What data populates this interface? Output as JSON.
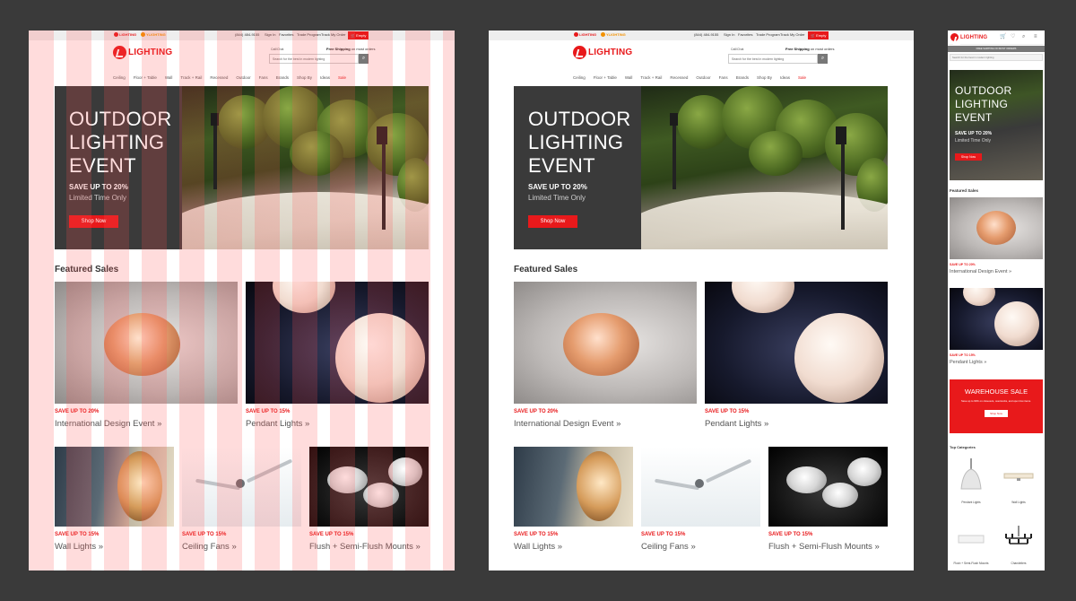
{
  "topbar": {
    "brand1": "LIGHTING",
    "brand2": "YLIGHTING",
    "phone": "(844) 484-9155",
    "links": [
      "Sign In",
      "Favorites",
      "Trade Program",
      "Track My Order"
    ],
    "cart": "Empty",
    "call_us": "Call/Chat"
  },
  "logo": {
    "text": "LIGHTING"
  },
  "shipping": {
    "bold": "Free Shipping",
    "rest": " on most orders"
  },
  "search": {
    "placeholder": "Search for the best in modern lighting"
  },
  "nav": [
    "Ceiling",
    "Floor + Table",
    "Wall",
    "Track + Rail",
    "Recessed",
    "Outdoor",
    "Fans",
    "Brands",
    "Shop By",
    "Ideas",
    "Sale"
  ],
  "hero": {
    "title_lines": [
      "OUTDOOR",
      "LIGHTING",
      "EVENT"
    ],
    "save": "SAVE UP TO 20%",
    "sub": "Limited Time Only",
    "button": "Shop Now"
  },
  "featured": {
    "title": "Featured Sales",
    "cards": [
      {
        "save": "SAVE UP TO 20%",
        "label": "International Design Event »"
      },
      {
        "save": "SAVE UP TO 15%",
        "label": "Pendant Lights »"
      },
      {
        "save": "SAVE UP TO 15%",
        "label": "Wall Lights »"
      },
      {
        "save": "SAVE UP TO 15%",
        "label": "Ceiling Fans »"
      },
      {
        "save": "SAVE UP TO 15%",
        "label": "Flush + Semi-Flush Mounts »"
      }
    ]
  },
  "mobile": {
    "banner": "FREE SHIPPING ON MOST ORDERS",
    "search_placeholder": "Search for the best in modern lighting",
    "hero_title_lines": [
      "OUTDOOR",
      "LIGHTING",
      "EVENT"
    ],
    "hero_save": "SAVE UP TO 20%",
    "hero_sub": "Limited Time Only",
    "hero_button": "Shop Now",
    "featured_title": "Featured Sales",
    "card1_save": "SAVE UP TO 20%",
    "card1_label": "International Design Event »",
    "card2_save": "SAVE UP TO 15%",
    "card2_label": "Pendant Lights »",
    "warehouse": {
      "title": "WAREHOUSE SALE",
      "desc": "Save up to 60% on closeouts, overstocks, and open box items.",
      "button": "Shop Now"
    },
    "categories_title": "Top Categories",
    "categories": [
      "Pendant Lights",
      "Wall Lights",
      "Flush + Semi-Flush Mounts",
      "Chandeliers"
    ]
  },
  "colors": {
    "brand_red": "#e8191b",
    "hero_dark": "#3a3a3a",
    "background": "#3a3a3a"
  }
}
